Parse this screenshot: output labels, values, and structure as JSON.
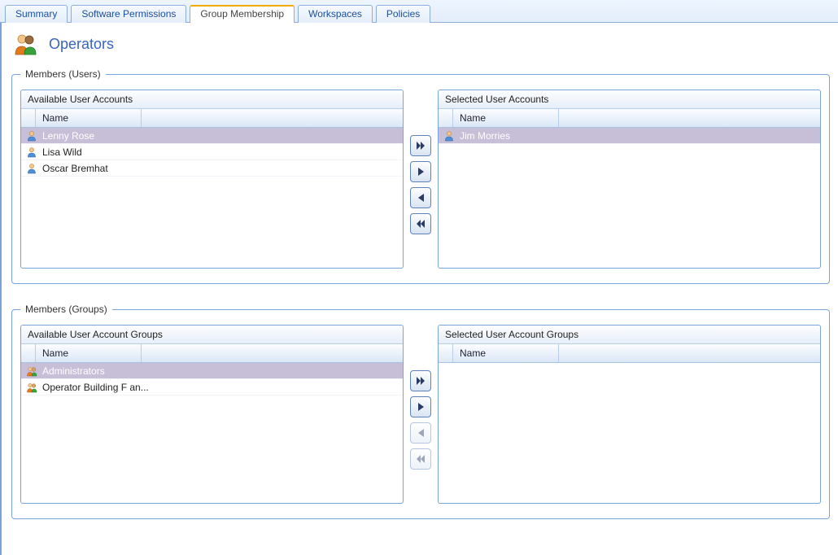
{
  "tabs": [
    {
      "label": "Summary"
    },
    {
      "label": "Software Permissions"
    },
    {
      "label": "Group Membership"
    },
    {
      "label": "Workspaces"
    },
    {
      "label": "Policies"
    }
  ],
  "active_tab_index": 2,
  "header": {
    "title": "Operators"
  },
  "users_section": {
    "legend": "Members (Users)",
    "available": {
      "title": "Available User Accounts",
      "column": "Name",
      "rows": [
        {
          "label": "Lenny Rose",
          "selected": true
        },
        {
          "label": "Lisa Wild",
          "selected": false
        },
        {
          "label": "Oscar Bremhat",
          "selected": false
        }
      ]
    },
    "selected": {
      "title": "Selected User Accounts",
      "column": "Name",
      "rows": [
        {
          "label": "Jim Morries",
          "selected": true
        }
      ]
    },
    "buttons": {
      "add_all_enabled": true,
      "add_enabled": true,
      "remove_enabled": true,
      "remove_all_enabled": true
    }
  },
  "groups_section": {
    "legend": "Members (Groups)",
    "available": {
      "title": "Available User Account Groups",
      "column": "Name",
      "rows": [
        {
          "label": "Administrators",
          "selected": true
        },
        {
          "label": "Operator Building F an...",
          "selected": false
        }
      ]
    },
    "selected": {
      "title": "Selected User Account Groups",
      "column": "Name",
      "rows": []
    },
    "buttons": {
      "add_all_enabled": true,
      "add_enabled": true,
      "remove_enabled": false,
      "remove_all_enabled": false
    }
  }
}
